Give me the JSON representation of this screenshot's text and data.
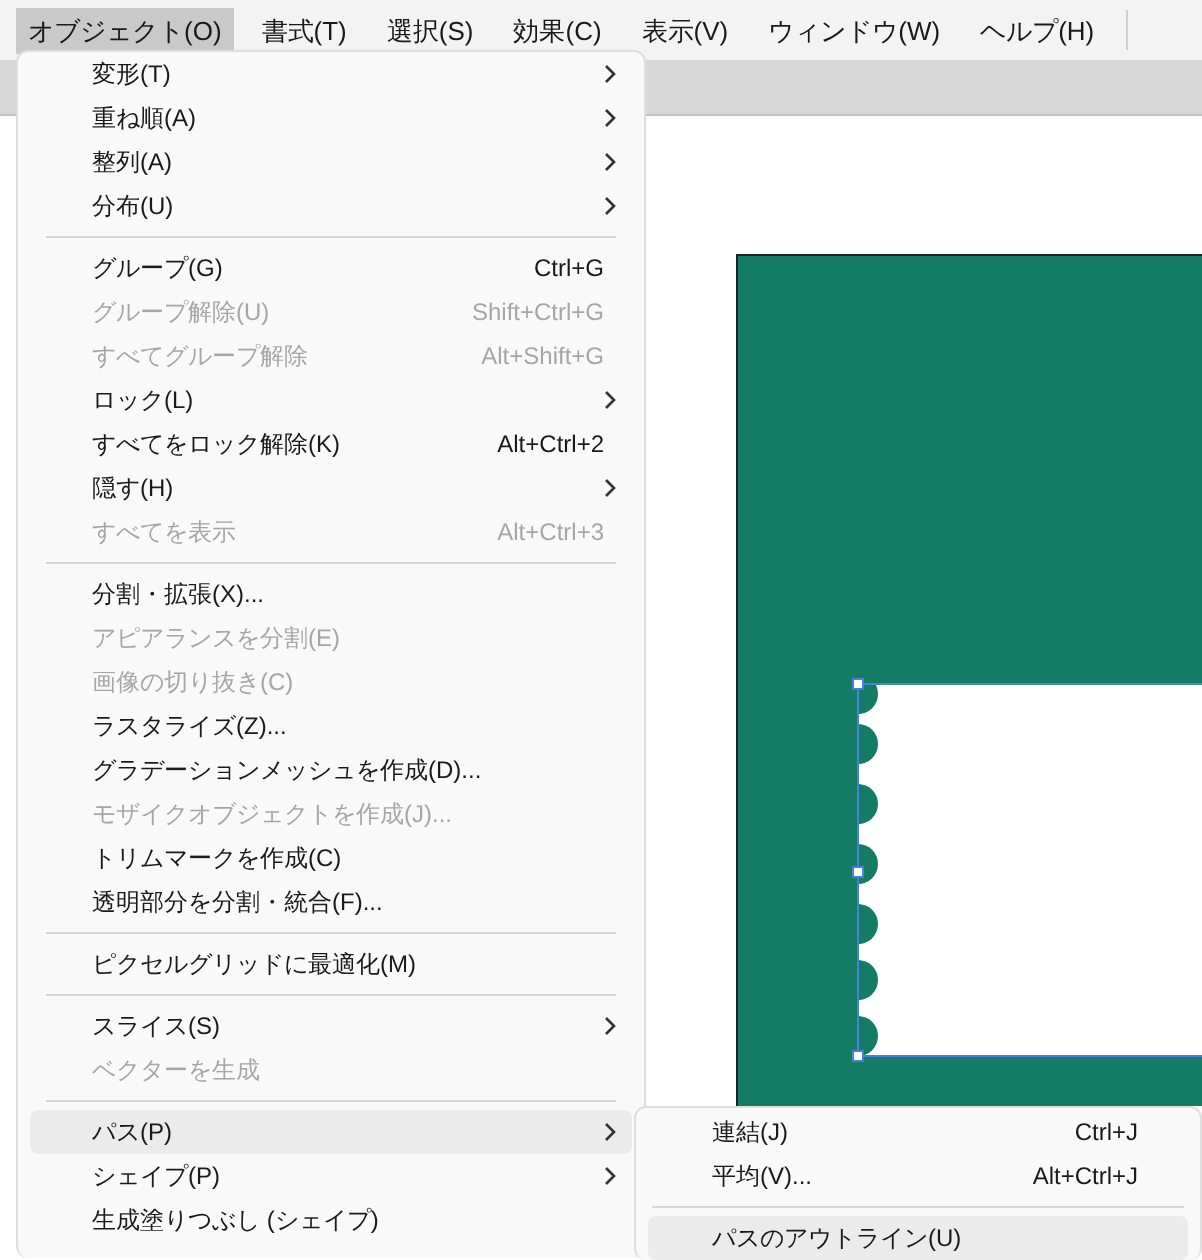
{
  "menubar": [
    {
      "label": "オブジェクト(O)",
      "selected": true
    },
    {
      "label": "書式(T)",
      "selected": false
    },
    {
      "label": "選択(S)",
      "selected": false
    },
    {
      "label": "効果(C)",
      "selected": false
    },
    {
      "label": "表示(V)",
      "selected": false
    },
    {
      "label": "ウィンドウ(W)",
      "selected": false
    },
    {
      "label": "ヘルプ(H)",
      "selected": false
    }
  ],
  "menu": {
    "sections": [
      [
        {
          "label": "変形(T)",
          "submenu": true,
          "disabled": false,
          "selected": false
        },
        {
          "label": "重ね順(A)",
          "submenu": true,
          "disabled": false,
          "selected": false
        },
        {
          "label": "整列(A)",
          "submenu": true,
          "disabled": false,
          "selected": false
        },
        {
          "label": "分布(U)",
          "submenu": true,
          "disabled": false,
          "selected": false
        }
      ],
      [
        {
          "label": "グループ(G)",
          "shortcut": "Ctrl+G",
          "submenu": false,
          "disabled": false,
          "selected": false
        },
        {
          "label": "グループ解除(U)",
          "shortcut": "Shift+Ctrl+G",
          "submenu": false,
          "disabled": true,
          "selected": false
        },
        {
          "label": "すべてグループ解除",
          "shortcut": "Alt+Shift+G",
          "submenu": false,
          "disabled": true,
          "selected": false
        },
        {
          "label": "ロック(L)",
          "submenu": true,
          "disabled": false,
          "selected": false
        },
        {
          "label": "すべてをロック解除(K)",
          "shortcut": "Alt+Ctrl+2",
          "submenu": false,
          "disabled": false,
          "selected": false
        },
        {
          "label": "隠す(H)",
          "submenu": true,
          "disabled": false,
          "selected": false
        },
        {
          "label": "すべてを表示",
          "shortcut": "Alt+Ctrl+3",
          "submenu": false,
          "disabled": true,
          "selected": false
        }
      ],
      [
        {
          "label": "分割・拡張(X)...",
          "submenu": false,
          "disabled": false,
          "selected": false
        },
        {
          "label": "アピアランスを分割(E)",
          "submenu": false,
          "disabled": true,
          "selected": false
        },
        {
          "label": "画像の切り抜き(C)",
          "submenu": false,
          "disabled": true,
          "selected": false
        },
        {
          "label": "ラスタライズ(Z)...",
          "submenu": false,
          "disabled": false,
          "selected": false
        },
        {
          "label": "グラデーションメッシュを作成(D)...",
          "submenu": false,
          "disabled": false,
          "selected": false
        },
        {
          "label": "モザイクオブジェクトを作成(J)...",
          "submenu": false,
          "disabled": true,
          "selected": false
        },
        {
          "label": "トリムマークを作成(C)",
          "submenu": false,
          "disabled": false,
          "selected": false
        },
        {
          "label": "透明部分を分割・統合(F)...",
          "submenu": false,
          "disabled": false,
          "selected": false
        }
      ],
      [
        {
          "label": "ピクセルグリッドに最適化(M)",
          "submenu": false,
          "disabled": false,
          "selected": false
        }
      ],
      [
        {
          "label": "スライス(S)",
          "submenu": true,
          "disabled": false,
          "selected": false
        },
        {
          "label": "ベクターを生成",
          "submenu": false,
          "disabled": true,
          "selected": false
        }
      ],
      [
        {
          "label": "パス(P)",
          "submenu": true,
          "disabled": false,
          "selected": true
        },
        {
          "label": "シェイプ(P)",
          "submenu": true,
          "disabled": false,
          "selected": false
        },
        {
          "label": "生成塗りつぶし (シェイプ)",
          "submenu": false,
          "disabled": false,
          "selected": false
        }
      ]
    ]
  },
  "submenu": {
    "sections": [
      [
        {
          "label": "連結(J)",
          "shortcut": "Ctrl+J",
          "submenu": false,
          "disabled": false,
          "selected": false
        },
        {
          "label": "平均(V)...",
          "shortcut": "Alt+Ctrl+J",
          "submenu": false,
          "disabled": false,
          "selected": false
        }
      ],
      [
        {
          "label": "パスのアウトライン(U)",
          "submenu": false,
          "disabled": false,
          "selected": true
        }
      ]
    ]
  }
}
